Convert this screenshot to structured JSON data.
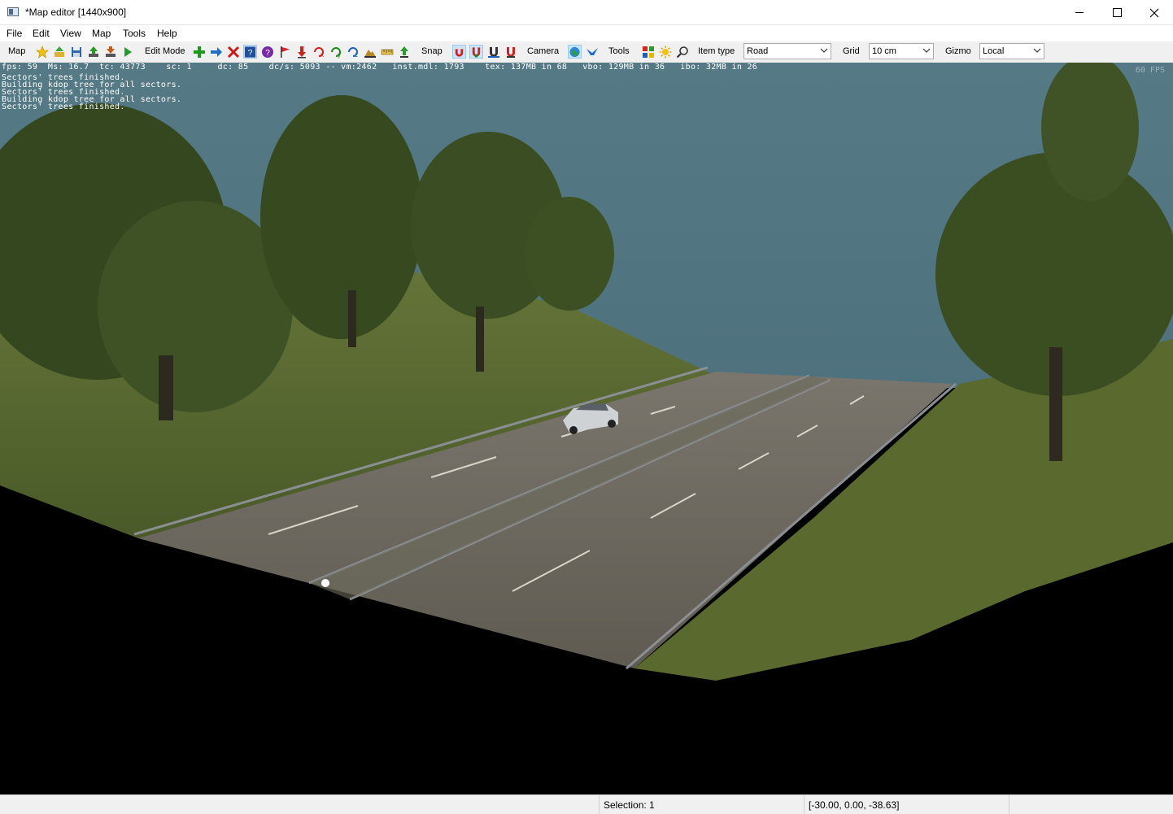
{
  "window": {
    "title": "*Map editor [1440x900]",
    "minimize": "minimize",
    "maximize": "maximize",
    "close": "close"
  },
  "menu": [
    "File",
    "Edit",
    "View",
    "Map",
    "Tools",
    "Help"
  ],
  "toolbar": {
    "map_label": "Map",
    "edit_mode_label": "Edit Mode",
    "snap_label": "Snap",
    "camera_label": "Camera",
    "tools_label": "Tools",
    "item_type_label": "Item type",
    "item_type_value": "Road",
    "grid_label": "Grid",
    "grid_value": "10 cm",
    "gizmo_label": "Gizmo",
    "gizmo_value": "Local"
  },
  "viewport": {
    "stats": "fps: 59  Ms: 16.7  tc: 43773    sc: 1     dc: 85    dc/s: 5093 -- vm:2462   inst.mdl: 1793    tex: 137MB in 68   vbo: 129MB in 36   ibo: 32MB in 26",
    "log": [
      "Sectors' trees finished.",
      "Building kdop tree for all sectors.",
      "Sectors' trees finished.",
      "Building kdop tree for all sectors.",
      "Sectors' trees finished."
    ],
    "fps_corner": "60 FPS"
  },
  "status": {
    "selection": "Selection: 1",
    "coordinates": "[-30.00, 0.00, -38.63]"
  },
  "colors": {
    "sky": "#4f7380",
    "grass": "#5d6a35",
    "tree": "#3b4f25",
    "road": "#6f6a60",
    "accent": "#cce4f7"
  }
}
